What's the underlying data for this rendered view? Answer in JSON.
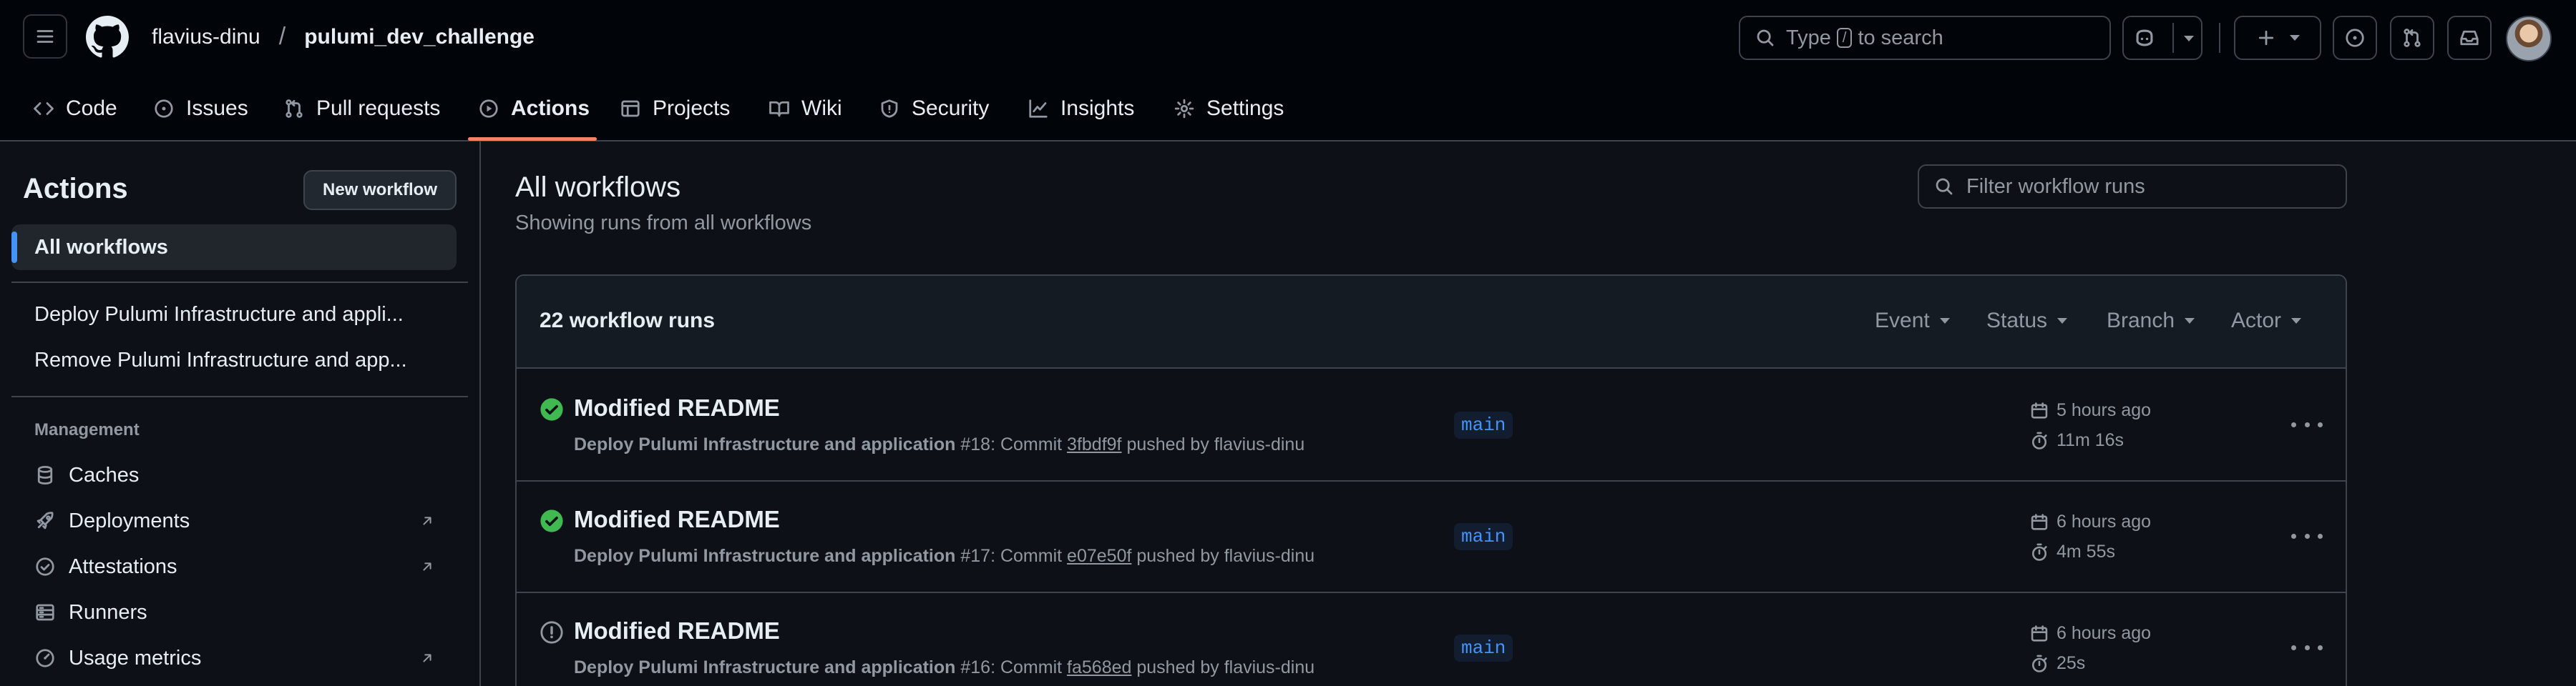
{
  "header": {
    "owner": "flavius-dinu",
    "separator": "/",
    "repo": "pulumi_dev_challenge",
    "search_prefix": "Type",
    "search_key": "/",
    "search_suffix": "to search"
  },
  "nav": {
    "tabs": [
      {
        "label": "Code",
        "icon": "code-icon"
      },
      {
        "label": "Issues",
        "icon": "issue-icon"
      },
      {
        "label": "Pull requests",
        "icon": "pull-request-icon"
      },
      {
        "label": "Actions",
        "icon": "play-icon",
        "active": true
      },
      {
        "label": "Projects",
        "icon": "table-icon"
      },
      {
        "label": "Wiki",
        "icon": "book-icon"
      },
      {
        "label": "Security",
        "icon": "shield-icon"
      },
      {
        "label": "Insights",
        "icon": "graph-icon"
      },
      {
        "label": "Settings",
        "icon": "gear-icon"
      }
    ]
  },
  "sidebar": {
    "title": "Actions",
    "new_workflow": "New workflow",
    "all_workflows": "All workflows",
    "workflows": [
      "Deploy Pulumi Infrastructure and appli...",
      "Remove Pulumi Infrastructure and app..."
    ],
    "management_heading": "Management",
    "management": [
      {
        "label": "Caches",
        "icon": "database-icon",
        "external": false
      },
      {
        "label": "Deployments",
        "icon": "rocket-icon",
        "external": true
      },
      {
        "label": "Attestations",
        "icon": "verified-icon",
        "external": true
      },
      {
        "label": "Runners",
        "icon": "server-icon",
        "external": false
      },
      {
        "label": "Usage metrics",
        "icon": "meter-icon",
        "external": true
      }
    ]
  },
  "main": {
    "title": "All workflows",
    "subtitle": "Showing runs from all workflows",
    "filter_placeholder": "Filter workflow runs",
    "runs_count": "22 workflow runs",
    "filters": [
      "Event",
      "Status",
      "Branch",
      "Actor"
    ],
    "runs": [
      {
        "title": "Modified README",
        "status": "success",
        "workflow": "Deploy Pulumi Infrastructure and application",
        "number": "#18: Commit",
        "sha": "3fbdf9f",
        "pusher": "pushed by flavius-dinu",
        "branch": "main",
        "time": "5 hours ago",
        "duration": "11m 16s"
      },
      {
        "title": "Modified README",
        "status": "success",
        "workflow": "Deploy Pulumi Infrastructure and application",
        "number": "#17: Commit",
        "sha": "e07e50f",
        "pusher": "pushed by flavius-dinu",
        "branch": "main",
        "time": "6 hours ago",
        "duration": "4m 55s"
      },
      {
        "title": "Modified README",
        "status": "cancelled",
        "workflow": "Deploy Pulumi Infrastructure and application",
        "number": "#16: Commit",
        "sha": "fa568ed",
        "pusher": "pushed by flavius-dinu",
        "branch": "main",
        "time": "6 hours ago",
        "duration": "25s"
      }
    ]
  },
  "colors": {
    "background": "#0d1117",
    "header": "#010409",
    "success": "#3fb950",
    "accent": "#4493f8",
    "tab_underline": "#f78166",
    "muted": "#9198a1"
  }
}
